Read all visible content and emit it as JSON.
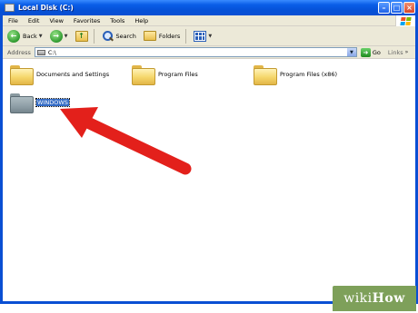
{
  "window": {
    "title": "Local Disk (C:)"
  },
  "menu": {
    "items": [
      "File",
      "Edit",
      "View",
      "Favorites",
      "Tools",
      "Help"
    ]
  },
  "toolbar": {
    "back_label": "Back",
    "search_label": "Search",
    "folders_label": "Folders"
  },
  "address": {
    "label": "Address",
    "value": "C:\\",
    "go_label": "Go",
    "links_label": "Links"
  },
  "folders": [
    {
      "name": "Documents and Settings",
      "selected": false
    },
    {
      "name": "Program Files",
      "selected": false
    },
    {
      "name": "Program Files (x86)",
      "selected": false
    },
    {
      "name": "WINDOWS",
      "selected": true
    }
  ],
  "annotation": {
    "arrow_color": "#e3201b"
  },
  "watermark": {
    "brand_light": "wiki",
    "brand_bold": "How"
  },
  "colors": {
    "titlebar": "#0a4fd3",
    "selection": "#316ac5",
    "chrome": "#ece9d8"
  }
}
